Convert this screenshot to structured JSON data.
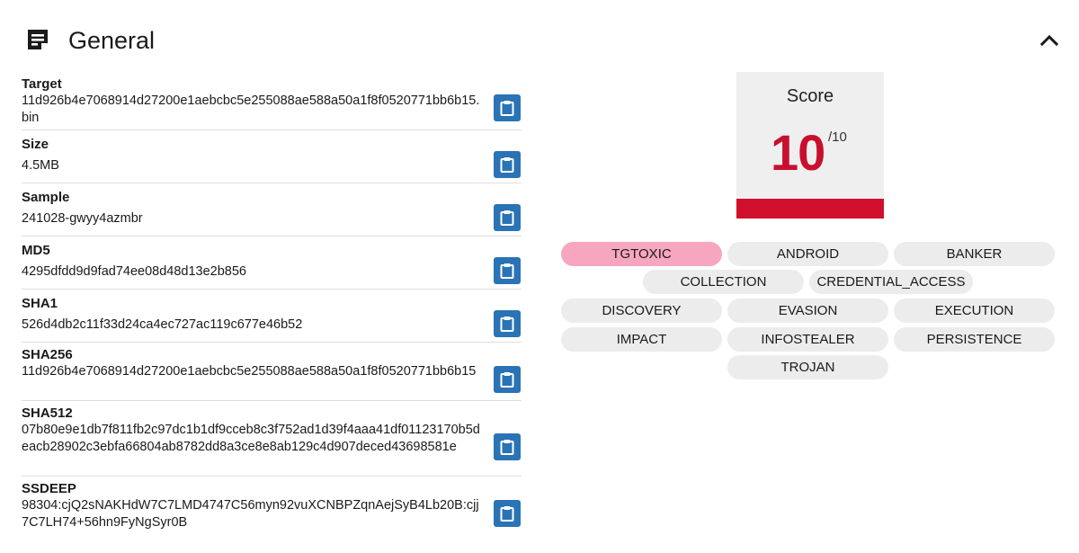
{
  "header": {
    "title": "General",
    "icon": "sticky-note-icon",
    "collapse_icon": "chevron-up-icon"
  },
  "info": [
    {
      "label": "Target",
      "value": "11d926b4e7068914d27200e1aebcbc5e255088ae588a50a1f8f0520771bb6b15.bin"
    },
    {
      "label": "Size",
      "value": "4.5MB"
    },
    {
      "label": "Sample",
      "value": "241028-gwyy4azmbr"
    },
    {
      "label": "MD5",
      "value": "4295dfdd9d9fad74ee08d48d13e2b856"
    },
    {
      "label": "SHA1",
      "value": "526d4db2c11f33d24ca4ec727ac119c677e46b52"
    },
    {
      "label": "SHA256",
      "value": "11d926b4e7068914d27200e1aebcbc5e255088ae588a50a1f8f0520771bb6b15"
    },
    {
      "label": "SHA512",
      "value": "07b80e9e1db7f811fb2c97dc1b1df9cceb8c3f752ad1d39f4aaa41df01123170b5deacb28902c3ebfa66804ab8782dd8a3ce8e8ab129c4d907deced43698581e"
    },
    {
      "label": "SSDEEP",
      "value": "98304:cjQ2sNAKHdW7C7LMD4747C56myn92vuXCNBPZqnAejSyB4Lb20B:cjj7C7LH74+56hn9FyNgSyr0B"
    }
  ],
  "score": {
    "title": "Score",
    "value": "10",
    "max": "/10",
    "color": "#c8102e"
  },
  "tags": [
    {
      "label": "TGTOXIC",
      "highlight": true
    },
    {
      "label": "ANDROID",
      "highlight": false
    },
    {
      "label": "BANKER",
      "highlight": false
    },
    {
      "label": "COLLECTION",
      "highlight": false
    },
    {
      "label": "CREDENTIAL_ACCESS",
      "highlight": false
    },
    {
      "label": "DISCOVERY",
      "highlight": false
    },
    {
      "label": "EVASION",
      "highlight": false
    },
    {
      "label": "EXECUTION",
      "highlight": false
    },
    {
      "label": "IMPACT",
      "highlight": false
    },
    {
      "label": "INFOSTEALER",
      "highlight": false
    },
    {
      "label": "PERSISTENCE",
      "highlight": false
    },
    {
      "label": "TROJAN",
      "highlight": false
    }
  ],
  "colors": {
    "copy_button": "#2a73b5",
    "score_bar": "#d0102c",
    "tag_default": "#ececec",
    "tag_highlight": "#f7a6bf"
  }
}
